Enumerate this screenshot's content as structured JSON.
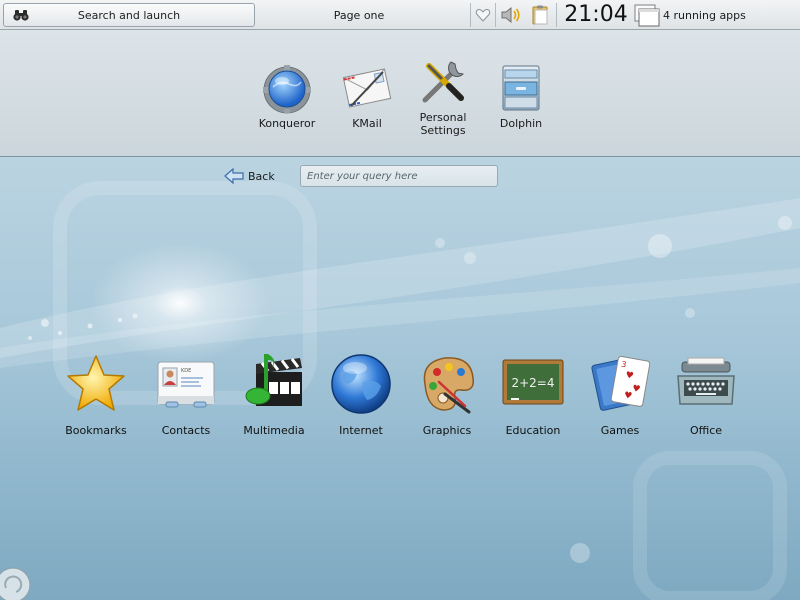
{
  "panel": {
    "launcher_label": "Search and launch",
    "page_label": "Page one",
    "clock": "21:04",
    "running_apps": "4 running apps"
  },
  "favorites": [
    {
      "label": "Konqueror",
      "icon": "konqueror-globe-gear-icon"
    },
    {
      "label": "KMail",
      "icon": "kmail-envelope-icon"
    },
    {
      "label": "Personal Settings",
      "icon": "settings-tools-icon"
    },
    {
      "label": "Dolphin",
      "icon": "dolphin-file-cabinet-icon"
    }
  ],
  "navigation": {
    "back_label": "Back",
    "search_placeholder": "Enter your query here"
  },
  "categories": [
    {
      "label": "Bookmarks",
      "icon": "star-icon"
    },
    {
      "label": "Contacts",
      "icon": "contact-card-icon"
    },
    {
      "label": "Multimedia",
      "icon": "clapperboard-music-icon"
    },
    {
      "label": "Internet",
      "icon": "globe-icon"
    },
    {
      "label": "Graphics",
      "icon": "paint-palette-icon"
    },
    {
      "label": "Education",
      "icon": "chalkboard-icon"
    },
    {
      "label": "Games",
      "icon": "playing-cards-icon"
    },
    {
      "label": "Office",
      "icon": "typewriter-icon"
    }
  ],
  "contact_card_text": "KDE"
}
